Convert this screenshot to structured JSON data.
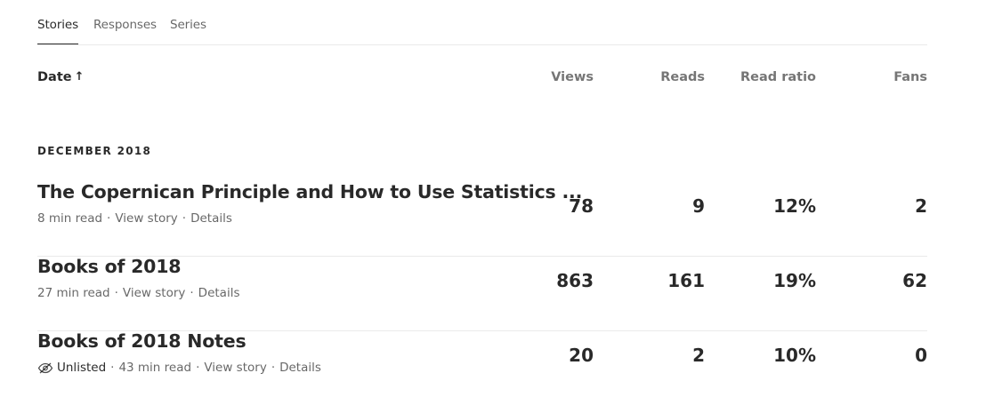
{
  "tabs": [
    {
      "label": "Stories",
      "active": true
    },
    {
      "label": "Responses",
      "active": false
    },
    {
      "label": "Series",
      "active": false
    }
  ],
  "columns": {
    "date": "Date",
    "sort_icon": "arrow-up-icon",
    "views": "Views",
    "reads": "Reads",
    "read_ratio": "Read ratio",
    "fans": "Fans"
  },
  "section": {
    "label": "DECEMBER 2018"
  },
  "stories": [
    {
      "title": "The Copernican Principle and How to Use Statistics ...",
      "read_time": "8 min read",
      "view_story": "View story",
      "details": "Details",
      "views": "78",
      "reads": "9",
      "read_ratio": "12%",
      "fans": "2"
    },
    {
      "title": "Books of 2018",
      "read_time": "27 min read",
      "view_story": "View story",
      "details": "Details",
      "views": "863",
      "reads": "161",
      "read_ratio": "19%",
      "fans": "62"
    },
    {
      "title": "Books of 2018 Notes",
      "unlisted_icon": "eye-slash-icon",
      "unlisted": "Unlisted",
      "read_time": "43 min read",
      "view_story": "View story",
      "details": "Details",
      "views": "20",
      "reads": "2",
      "read_ratio": "10%",
      "fans": "0"
    }
  ]
}
